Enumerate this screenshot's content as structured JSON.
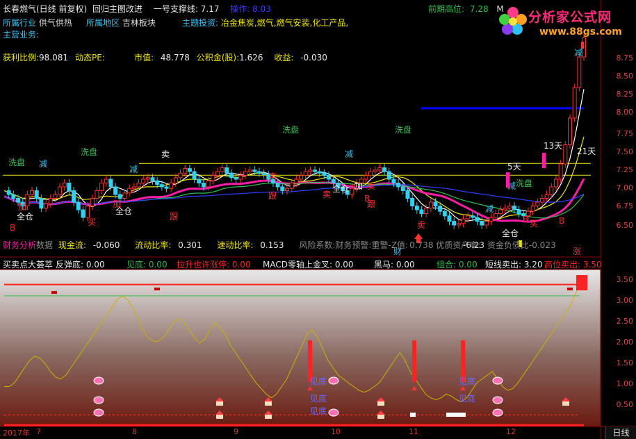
{
  "header": {
    "stock_name": "长春燃气(日线 前复权)",
    "mode": "回归主图改进",
    "support_label": "一号支撑线:",
    "support_value": "7.17",
    "operate_label": "操作:",
    "operate_value": "8.03",
    "prev_high_label": "前期高位:",
    "prev_high_value": "7.28",
    "ma_label": "M"
  },
  "info": {
    "industry_label": "所属行业",
    "industry_value": "供气供热",
    "region_label": "所属地区",
    "region_value": "吉林板块",
    "theme_label": "主题投资:",
    "theme_value": "冶金焦炭,燃气,燃气安装,化工产品,",
    "business_label": "主营业务:",
    "profit_ratio_label": "获利比例:",
    "profit_ratio_value": "98.081",
    "pe_label": "动态PE:",
    "mcap_label": "市值:",
    "mcap_value": "48.778",
    "fund_label": "公积金(股):",
    "fund_value": "1.626",
    "income_label": "收益:",
    "income_value": "-0.030"
  },
  "finance": {
    "title": "财务分析",
    "data_label": "数据",
    "cash_label": "现金流:",
    "cash_value": "-0.060",
    "liquid_label": "流动比率:",
    "liquid_value": "0.301",
    "quick_label": "速动比率:",
    "quick_value": "0.153",
    "risk_label": "风险系数:",
    "warn_label": "财务预警:",
    "warn_value": "重警",
    "z_label": "-Z值:",
    "z_value": "0.738",
    "asset_label": "优质资产率:",
    "asset_value": "-6.23",
    "debt_label": "资金负债比",
    "debt_value": "-0.023"
  },
  "logo": {
    "title": "分析家公式网",
    "url": "www.88gs.com"
  },
  "indicator": {
    "name": "买卖点大荟萃",
    "items": [
      {
        "label": "反弹底:",
        "value": "0.00",
        "color": "#e6e6e6"
      },
      {
        "label": "见底:",
        "value": "0.00",
        "color": "#31b84d"
      },
      {
        "label": "拉升也许涨停:",
        "value": "0.00",
        "color": "#ff2222"
      },
      {
        "label": "MACD零轴上金叉:",
        "value": "0.00",
        "color": "#e6e6e6"
      },
      {
        "label": "黑马:",
        "value": "0.00",
        "color": "#e6e6e6"
      },
      {
        "label": "组合:",
        "value": "0.00",
        "color": "#31b84d"
      },
      {
        "label": "短线卖出:",
        "value": "3.20",
        "color": "#e6e6e6"
      },
      {
        "label": "高位卖出:",
        "value": "3.50",
        "color": "#ff2222"
      }
    ]
  },
  "price_axis": [
    "8.75",
    "8.50",
    "8.25",
    "8.00",
    "7.75",
    "7.50",
    "7.25",
    "7.00",
    "6.75",
    "6.50"
  ],
  "ind_axis": [
    "3.50",
    "3.00",
    "2.50",
    "2.00",
    "1.50",
    "1.00",
    "0.50"
  ],
  "x_axis": [
    "2017年",
    "7",
    "8",
    "9",
    "10",
    "11",
    "12"
  ],
  "period_tab": "日线",
  "chart_labels": {
    "wash": "洗盘",
    "reduce": "减",
    "sell": "卖",
    "buy": "买",
    "follow": "跟",
    "full": "全仓",
    "add": "加",
    "B": "B",
    "days13": "13天",
    "days21": "21天",
    "days5": "5天",
    "cai": "财",
    "zhang": "涨",
    "see_bottom": "见底",
    "ksell": "卖"
  },
  "colors": {
    "accent_red": "#ff2222",
    "yellow": "#f2e600",
    "green": "#31c24d",
    "blue_line": "#0000ff",
    "magenta": "#ff1aa8",
    "cyan": "#1fd4e8"
  },
  "chart_data": {
    "type": "line",
    "price_ylim": [
      6.4,
      8.9
    ],
    "indicator_ylim": [
      0,
      3.75
    ],
    "support_level": 7.17,
    "prev_high_level": 7.28,
    "operate_level": 8.03,
    "close": [
      6.95,
      6.9,
      6.85,
      6.8,
      6.75,
      6.9,
      6.95,
      6.85,
      6.72,
      6.78,
      6.85,
      6.9,
      7.0,
      7.05,
      6.95,
      6.8,
      6.7,
      6.6,
      6.75,
      6.85,
      6.95,
      7.05,
      7.1,
      7.0,
      6.9,
      6.85,
      6.92,
      6.98,
      7.0,
      7.05,
      7.1,
      7.12,
      7.08,
      7.03,
      7.0,
      6.98,
      7.05,
      7.12,
      7.18,
      7.24,
      7.2,
      7.1,
      7.05,
      7.0,
      7.08,
      7.15,
      7.2,
      7.25,
      7.18,
      7.12,
      7.1,
      7.15,
      7.2,
      7.22,
      7.2,
      7.18,
      7.16,
      7.1,
      7.05,
      7.0,
      6.95,
      6.98,
      7.05,
      7.1,
      7.15,
      7.2,
      7.22,
      7.2,
      7.18,
      7.15,
      7.1,
      7.05,
      7.0,
      6.95,
      6.9,
      6.98,
      7.05,
      7.1,
      7.15,
      7.2,
      7.22,
      7.25,
      7.2,
      7.1,
      7.05,
      7.0,
      6.95,
      6.85,
      6.75,
      6.7,
      6.65,
      6.72,
      6.8,
      6.75,
      6.68,
      6.62,
      6.55,
      6.5,
      6.52,
      6.58,
      6.62,
      6.6,
      6.55,
      6.5,
      6.55,
      6.6,
      6.65,
      6.7,
      6.72,
      6.75,
      6.7,
      6.65,
      6.62,
      6.68,
      6.75,
      6.8,
      6.85,
      6.9,
      7.0,
      7.1,
      7.3,
      7.55,
      7.9,
      8.3,
      8.7,
      8.95
    ],
    "indicator": [
      0.8,
      0.8,
      0.9,
      1.1,
      1.3,
      1.5,
      1.6,
      1.55,
      1.4,
      1.2,
      1.05,
      1.0,
      1.1,
      1.3,
      1.5,
      1.7,
      1.9,
      2.1,
      2.3,
      2.5,
      2.7,
      2.9,
      3.1,
      3.2,
      3.1,
      2.9,
      2.6,
      2.3,
      2.1,
      2.0,
      2.0,
      2.1,
      2.3,
      2.5,
      2.6,
      2.5,
      2.3,
      2.1,
      1.95,
      2.05,
      2.3,
      2.5,
      2.35,
      2.2,
      1.9,
      1.7,
      1.5,
      1.3,
      1.1,
      0.9,
      0.75,
      0.6,
      0.5,
      0.6,
      0.8,
      1.0,
      1.3,
      1.6,
      1.9,
      2.2,
      2.3,
      2.1,
      1.8,
      1.5,
      1.3,
      1.1,
      1.0,
      0.9,
      0.8,
      0.7,
      0.65,
      0.7,
      0.8,
      0.9,
      1.1,
      1.3,
      1.5,
      1.7,
      1.5,
      1.2,
      1.0,
      0.8,
      0.6,
      0.5,
      0.45,
      0.5,
      0.6,
      0.55,
      0.45,
      0.4,
      0.5,
      0.7,
      0.9,
      1.0,
      1.1,
      1.2,
      1.0,
      0.8,
      0.7,
      0.75,
      0.9,
      1.1,
      1.3,
      1.5,
      1.7,
      1.9,
      2.1,
      2.3,
      2.5,
      2.7,
      2.9,
      3.2,
      3.5
    ]
  }
}
